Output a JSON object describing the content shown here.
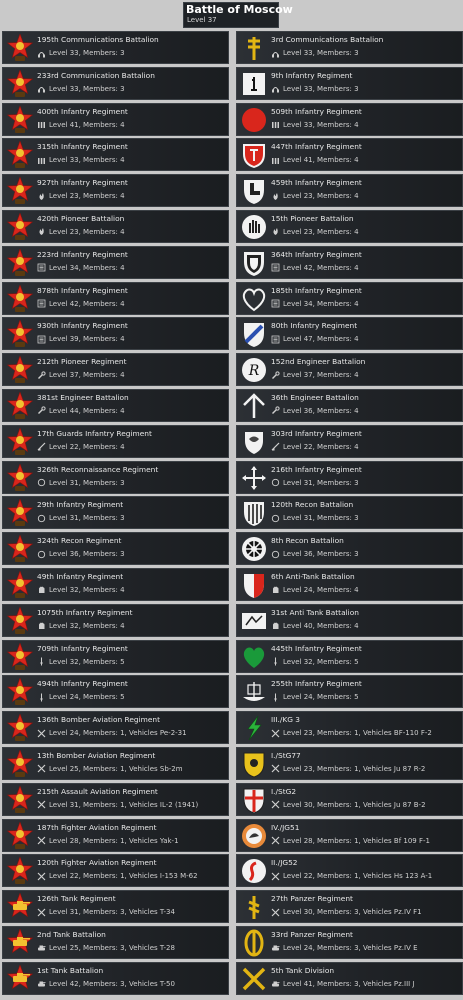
{
  "header": {
    "title": "Battle of Moscow",
    "subtitle": "Level 37"
  },
  "colors": {
    "soviet_red": "#d9261c",
    "soviet_gold": "#f2c230",
    "german_white": "#f2f2f2",
    "row_bg": "#23272b"
  },
  "left": [
    {
      "name": "195th Communications Battalion",
      "stats": "Level 33, Members: 3",
      "icon": "soviet-star-emblem",
      "role": "headphones-icon"
    },
    {
      "name": "233rd Communication Battalion",
      "stats": "Level 33, Members: 3",
      "icon": "soviet-star-emblem",
      "role": "headphones-icon"
    },
    {
      "name": "400th Infantry Regiment",
      "stats": "Level 41, Members: 4",
      "icon": "soviet-star-emblem",
      "role": "ammo-icon"
    },
    {
      "name": "315th Infantry Regiment",
      "stats": "Level 33, Members: 4",
      "icon": "soviet-star-emblem",
      "role": "ammo-icon"
    },
    {
      "name": "927th Infantry Regiment",
      "stats": "Level 23, Members: 4",
      "icon": "soviet-star-emblem",
      "role": "flame-icon"
    },
    {
      "name": "420th Pioneer Battalion",
      "stats": "Level 23, Members: 4",
      "icon": "soviet-star-emblem",
      "role": "flame-icon"
    },
    {
      "name": "223rd Infantry Regiment",
      "stats": "Level 34, Members: 4",
      "icon": "soviet-star-emblem",
      "role": "list-icon"
    },
    {
      "name": "878th Infantry Regiment",
      "stats": "Level 42, Members: 4",
      "icon": "soviet-star-emblem",
      "role": "list-icon"
    },
    {
      "name": "930th Infantry Regiment",
      "stats": "Level 39, Members: 4",
      "icon": "soviet-star-emblem",
      "role": "list-icon"
    },
    {
      "name": "212th Pioneer Regiment",
      "stats": "Level 37, Members: 4",
      "icon": "soviet-star-emblem",
      "role": "wrench-icon"
    },
    {
      "name": "381st Engineer Battalion",
      "stats": "Level 44, Members: 4",
      "icon": "soviet-star-emblem",
      "role": "wrench-icon"
    },
    {
      "name": "17th Guards Infantry Regiment",
      "stats": "Level 22, Members: 4",
      "icon": "soviet-star-emblem",
      "role": "rifle-icon"
    },
    {
      "name": "326th Reconnaissance Regiment",
      "stats": "Level 31, Members: 3",
      "icon": "soviet-star-emblem",
      "role": "scope-icon"
    },
    {
      "name": "29th Infantry Regiment",
      "stats": "Level 31, Members: 3",
      "icon": "soviet-star-emblem",
      "role": "scope-icon"
    },
    {
      "name": "324th Recon Regiment",
      "stats": "Level 36, Members: 3",
      "icon": "soviet-star-emblem",
      "role": "scope-icon"
    },
    {
      "name": "49th Infantry Regiment",
      "stats": "Level 32, Members: 4",
      "icon": "soviet-star-emblem",
      "role": "fist-icon"
    },
    {
      "name": "1075th Infantry Regiment",
      "stats": "Level 32, Members: 4",
      "icon": "soviet-star-emblem",
      "role": "fist-icon"
    },
    {
      "name": "709th Infantry Regiment",
      "stats": "Level 32, Members: 5",
      "icon": "soviet-star-emblem",
      "role": "bayonet-icon"
    },
    {
      "name": "494th Infantry Regiment",
      "stats": "Level 24, Members: 5",
      "icon": "soviet-star-emblem",
      "role": "bayonet-icon"
    },
    {
      "name": "136th Bomber Aviation Regiment",
      "stats": "Level 24, Members: 1, Vehicles Pe-2-31",
      "icon": "soviet-star-emblem",
      "role": "crossed-tools-icon"
    },
    {
      "name": "13th Bomber Aviation Regiment",
      "stats": "Level 25, Members: 1, Vehicles Sb-2m",
      "icon": "soviet-star-emblem",
      "role": "crossed-tools-icon"
    },
    {
      "name": "215th Assault Aviation Regiment",
      "stats": "Level 31, Members: 1, Vehicles IL-2 (1941)",
      "icon": "soviet-star-emblem",
      "role": "crossed-tools-icon"
    },
    {
      "name": "187th Fighter Aviation Regiment",
      "stats": "Level 28, Members: 1, Vehicles Yak-1",
      "icon": "soviet-star-emblem",
      "role": "crossed-tools-icon"
    },
    {
      "name": "120th Fighter Aviation Regiment",
      "stats": "Level 22, Members: 1, Vehicles I-153 M-62",
      "icon": "soviet-star-emblem",
      "role": "crossed-tools-icon"
    },
    {
      "name": "126th Tank Regiment",
      "stats": "Level 31, Members: 3, Vehicles T-34",
      "icon": "soviet-tank-emblem",
      "role": "crossed-tools-icon"
    },
    {
      "name": "2nd Tank Battalion",
      "stats": "Level 25, Members: 3, Vehicles T-28",
      "icon": "soviet-tank-emblem",
      "role": "tank-icon"
    },
    {
      "name": "1st Tank Battalion",
      "stats": "Level 42, Members: 3, Vehicles T-50",
      "icon": "soviet-tank-emblem",
      "role": "tank-icon"
    }
  ],
  "right": [
    {
      "name": "3rd Communications Battalion",
      "stats": "Level 33, Members: 3",
      "icon": "double-cross-emblem",
      "role": "headphones-icon"
    },
    {
      "name": "9th Infantry Regiment",
      "stats": "Level 33, Members: 3",
      "icon": "key-shield-emblem",
      "role": "headphones-icon"
    },
    {
      "name": "509th Infantry Regiment",
      "stats": "Level 33, Members: 4",
      "icon": "red-circle-emblem",
      "role": "ammo-icon"
    },
    {
      "name": "447th Infantry Regiment",
      "stats": "Level 41, Members: 4",
      "icon": "red-shield-emblem",
      "role": "ammo-icon"
    },
    {
      "name": "459th Infantry Regiment",
      "stats": "Level 23, Members: 4",
      "icon": "boot-emblem",
      "role": "flame-icon"
    },
    {
      "name": "15th Pioneer Battalion",
      "stats": "Level 23, Members: 4",
      "icon": "hand-shield-emblem",
      "role": "flame-icon"
    },
    {
      "name": "364th Infantry Regiment",
      "stats": "Level 42, Members: 4",
      "icon": "white-shield-emblem",
      "role": "list-icon"
    },
    {
      "name": "185th Infantry Regiment",
      "stats": "Level 34, Members: 4",
      "icon": "heart-outline-emblem",
      "role": "list-icon"
    },
    {
      "name": "80th Infantry Regiment",
      "stats": "Level 47, Members: 4",
      "icon": "blue-stripe-shield-emblem",
      "role": "list-icon"
    },
    {
      "name": "152nd Engineer Battalion",
      "stats": "Level 37, Members: 4",
      "icon": "letter-r-emblem",
      "role": "wrench-icon"
    },
    {
      "name": "36th Engineer Battalion",
      "stats": "Level 36, Members: 4",
      "icon": "rune-arrow-emblem",
      "role": "wrench-icon"
    },
    {
      "name": "303rd Infantry Regiment",
      "stats": "Level 22, Members: 4",
      "icon": "crest-emblem",
      "role": "rifle-icon"
    },
    {
      "name": "216th Infantry Regiment",
      "stats": "Level 31, Members: 3",
      "icon": "cross-arrows-emblem",
      "role": "scope-icon"
    },
    {
      "name": "120th Recon Battalion",
      "stats": "Level 31, Members: 3",
      "icon": "striped-shield-emblem",
      "role": "scope-icon"
    },
    {
      "name": "8th Recon Battalion",
      "stats": "Level 36, Members: 3",
      "icon": "wheel-emblem",
      "role": "scope-icon"
    },
    {
      "name": "6th Anti-Tank Battalion",
      "stats": "Level 24, Members: 4",
      "icon": "red-white-shield-emblem",
      "role": "fist-icon"
    },
    {
      "name": "31st Anti Tank Battalion",
      "stats": "Level 40, Members: 4",
      "icon": "flag-emblem",
      "role": "fist-icon"
    },
    {
      "name": "445th Infantry Regiment",
      "stats": "Level 32, Members: 5",
      "icon": "green-heart-emblem",
      "role": "bayonet-icon"
    },
    {
      "name": "255th Infantry Regiment",
      "stats": "Level 24, Members: 5",
      "icon": "viking-ship-emblem",
      "role": "bayonet-icon"
    },
    {
      "name": "III./KG 3",
      "stats": "Level 23, Members: 1, Vehicles BF-110 F-2",
      "icon": "green-lightning-emblem",
      "role": "crossed-tools-icon"
    },
    {
      "name": "I./StG77",
      "stats": "Level 23, Members: 1, Vehicles Ju 87 R-2",
      "icon": "yellow-shield-emblem",
      "role": "crossed-tools-icon"
    },
    {
      "name": "I./StG2",
      "stats": "Level 30, Members: 1, Vehicles Ju 87 B-2",
      "icon": "red-cross-shield-emblem",
      "role": "crossed-tools-icon"
    },
    {
      "name": "IV./JG51",
      "stats": "Level 28, Members: 1, Vehicles Bf 109 F-1",
      "icon": "bird-emblem",
      "role": "crossed-tools-icon"
    },
    {
      "name": "II./JG52",
      "stats": "Level 22, Members: 1, Vehicles Hs 123 A-1",
      "icon": "seahorse-emblem",
      "role": "crossed-tools-icon"
    },
    {
      "name": "27th Panzer Regiment",
      "stats": "Level 30, Members: 3, Vehicles Pz.IV F1",
      "icon": "yellow-rune-emblem",
      "role": "crossed-tools-icon"
    },
    {
      "name": "33rd Panzer Regiment",
      "stats": "Level 24, Members: 3, Vehicles Pz.IV E",
      "icon": "yellow-circle-emblem",
      "role": "tank-icon"
    },
    {
      "name": "5th Tank Division",
      "stats": "Level 41, Members: 3, Vehicles Pz.III J",
      "icon": "yellow-x-emblem",
      "role": "tank-icon"
    }
  ]
}
